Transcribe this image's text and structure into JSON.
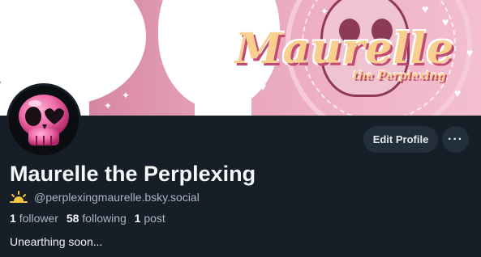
{
  "banner": {
    "logo_title": "Maurelle",
    "logo_subtitle": "the Perplexing"
  },
  "actions": {
    "edit_label": "Edit Profile",
    "more_label": "···"
  },
  "profile": {
    "display_name": "Maurelle the Perplexing",
    "handle": "@perplexingmaurelle.bsky.social",
    "handle_icon": "sun-icon",
    "followers_count": "1",
    "followers_label": "follower",
    "following_count": "58",
    "following_label": "following",
    "posts_count": "1",
    "posts_label": "post",
    "bio": "Unearthing soon..."
  },
  "colors": {
    "background": "#161e27",
    "button_bg": "#232f3c",
    "muted_text": "#a9b6c3",
    "avatar_pink": "#f06ba8",
    "banner_pink": "#e6a3b9",
    "logo_gold": "#f9cf8f"
  }
}
